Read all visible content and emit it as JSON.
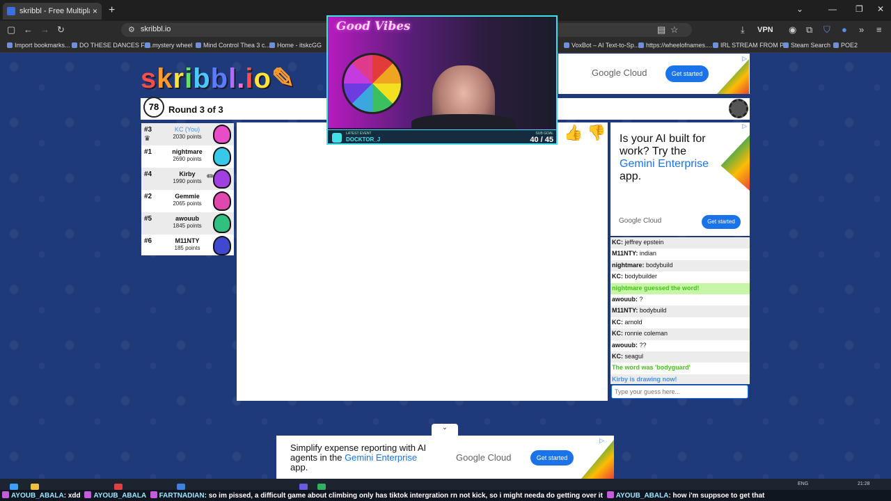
{
  "browser": {
    "tab_title": "skribbl - Free Multiplayer D",
    "tab_close": "×",
    "new_tab": "+",
    "url": "skribbl.io",
    "vpn_label": "VPN",
    "bookmarks": [
      "Import bookmarks...",
      "DO THESE DANCES FA...",
      "mystery wheel",
      "Mind Control Thea 3 c...",
      "Home - itskcGG",
      "VoxBot – AI Text-to-Sp...",
      "https://wheelofnames....",
      "IRL STREAM FROM PC",
      "Steam Search",
      "POE2"
    ]
  },
  "game": {
    "logo": "skribbl.io",
    "timer": "78",
    "round": "Round 3 of 3",
    "players": [
      {
        "rank": "#3",
        "name": "KC (You)",
        "points": "2030 points",
        "you": true,
        "color": "#e84cc6"
      },
      {
        "rank": "#1",
        "name": "nightmare",
        "points": "2690 points",
        "you": false,
        "color": "#38c8e8"
      },
      {
        "rank": "#4",
        "name": "Kirby",
        "points": "1990 points",
        "you": false,
        "color": "#a040e0"
      },
      {
        "rank": "#2",
        "name": "Gemmie",
        "points": "2065 points",
        "you": false,
        "color": "#e048b0"
      },
      {
        "rank": "#5",
        "name": "awouub",
        "points": "1845 points",
        "you": false,
        "color": "#30c080"
      },
      {
        "rank": "#6",
        "name": "M11NTY",
        "points": "185 points",
        "you": false,
        "color": "#4048d0"
      }
    ],
    "chat": [
      {
        "user": "KC:",
        "text": "jeffrey epstein",
        "kind": "normal"
      },
      {
        "user": "M11NTY:",
        "text": "indian",
        "kind": "normal"
      },
      {
        "user": "nightmare:",
        "text": "bodybuild",
        "kind": "normal"
      },
      {
        "user": "KC:",
        "text": "bodybuilder",
        "kind": "normal"
      },
      {
        "user": "",
        "text": "nightmare guessed the word!",
        "kind": "correct"
      },
      {
        "user": "awouub:",
        "text": "?",
        "kind": "normal"
      },
      {
        "user": "M11NTY:",
        "text": "bodybuild",
        "kind": "normal"
      },
      {
        "user": "KC:",
        "text": "arnold",
        "kind": "normal"
      },
      {
        "user": "KC:",
        "text": "ronnie coleman",
        "kind": "normal"
      },
      {
        "user": "awouub:",
        "text": "??",
        "kind": "normal"
      },
      {
        "user": "KC:",
        "text": "seagul",
        "kind": "normal"
      },
      {
        "user": "",
        "text": "The word was 'bodyguard'",
        "kind": "word"
      },
      {
        "user": "",
        "text": "Kirby is drawing now!",
        "kind": "draw"
      }
    ],
    "chat_placeholder": "Type your guess here..."
  },
  "stream": {
    "sign": "Good Vibes",
    "event_label": "LATEST EVENT",
    "event_name": "DOCKTOR_J",
    "goal_label": "SUB GOAL",
    "goal": "40 / 45"
  },
  "ads": {
    "top": {
      "brand": "Google Cloud",
      "cta": "Get started"
    },
    "side": {
      "headline_a": "Is your AI built for work? Try the ",
      "headline_b": "Gemini Enterprise",
      "headline_c": " app.",
      "brand": "Google Cloud",
      "cta": "Get started"
    },
    "bottom": {
      "headline_a": "Simplify expense reporting with AI agents in the ",
      "headline_b": "Gemini Enterprise",
      "headline_c": " app.",
      "brand": "Google Cloud",
      "cta": "Get started"
    }
  },
  "ticker": {
    "items": [
      {
        "user": "AYOUB_ABALA",
        "text": ": xdd"
      },
      {
        "user": "AYOUB_ABALA",
        "text": ""
      },
      {
        "user": "FARTNADIAN",
        "text": ": so im pissed, a difficult game about climbing only has tiktok intergration rn not kick, so i might needa do getting over it"
      },
      {
        "user": "AYOUB_ABALA",
        "text": ": how i'm suppsoe to get that"
      }
    ]
  },
  "taskbar": {
    "lang": "ENG",
    "time": "21:28"
  },
  "colors": {
    "accent": "#1a73e8",
    "stream_border": "#44e0e8",
    "correct_green": "#46c21a"
  }
}
